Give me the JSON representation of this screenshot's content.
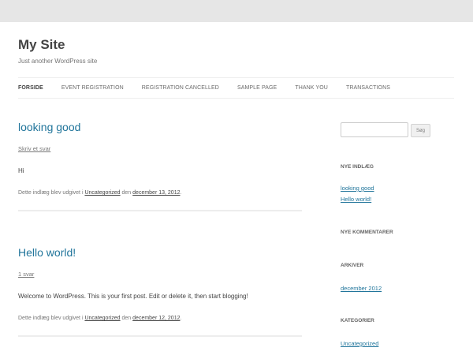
{
  "site": {
    "title": "My Site",
    "description": "Just another WordPress site"
  },
  "nav": {
    "items": [
      {
        "label": "FORSIDE",
        "current": true
      },
      {
        "label": "EVENT REGISTRATION"
      },
      {
        "label": "REGISTRATION CANCELLED"
      },
      {
        "label": "SAMPLE PAGE"
      },
      {
        "label": "THANK YOU"
      },
      {
        "label": "TRANSACTIONS"
      }
    ]
  },
  "posts": [
    {
      "title": "looking good",
      "comments": "Skriv et svar",
      "body": "Hi",
      "meta_prefix": "Dette indlæg blev udgivet i ",
      "category": "Uncategorized",
      "meta_mid": " den ",
      "date": "december 13, 2012",
      "meta_suffix": "."
    },
    {
      "title": "Hello world!",
      "comments": "1 svar",
      "body": "Welcome to WordPress. This is your first post. Edit or delete it, then start blogging!",
      "meta_prefix": "Dette indlæg blev udgivet i ",
      "category": "Uncategorized",
      "meta_mid": " den ",
      "date": "december 12, 2012",
      "meta_suffix": "."
    }
  ],
  "sidebar": {
    "search_button": "Søg",
    "recent_posts_title": "NYE INDLÆG",
    "recent_posts": [
      "looking good",
      "Hello world!"
    ],
    "recent_comments_title": "NYE KOMMENTARER",
    "archives_title": "ARKIVER",
    "archives": [
      "december 2012"
    ],
    "categories_title": "KATEGORIER",
    "categories": [
      "Uncategorized"
    ]
  },
  "colors": {
    "link": "#21759b",
    "text": "#444444",
    "background": "#e6e6e6"
  }
}
